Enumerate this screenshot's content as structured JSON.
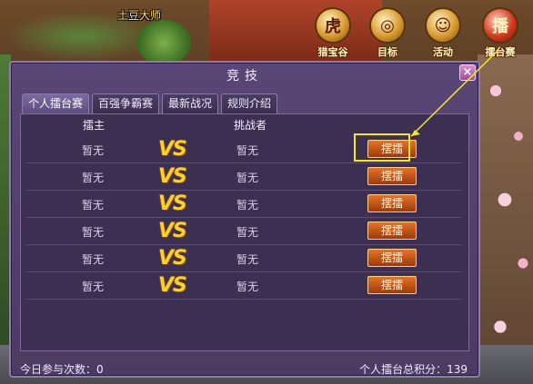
{
  "scene": {
    "player_name": "土豆大师"
  },
  "top_menu": [
    {
      "label": "猎宝谷",
      "icon": "treasure-tiger-icon"
    },
    {
      "label": "目标",
      "icon": "target-icon"
    },
    {
      "label": "活动",
      "icon": "event-icon"
    },
    {
      "label": "擂台赛",
      "icon": "arena-icon",
      "glyph": "播"
    }
  ],
  "dialog": {
    "title": "竞技",
    "close_label": "×",
    "tabs": [
      {
        "label": "个人擂台赛",
        "active": true
      },
      {
        "label": "百强争霸赛",
        "active": false
      },
      {
        "label": "最新战况",
        "active": false
      },
      {
        "label": "规则介绍",
        "active": false
      }
    ],
    "columns": {
      "host": "擂主",
      "challenger": "挑战者"
    },
    "rows": [
      {
        "host": "暂无",
        "vs": "VS",
        "challenger": "暂无",
        "action": "摆擂"
      },
      {
        "host": "暂无",
        "vs": "VS",
        "challenger": "暂无",
        "action": "摆擂"
      },
      {
        "host": "暂无",
        "vs": "VS",
        "challenger": "暂无",
        "action": "摆擂"
      },
      {
        "host": "暂无",
        "vs": "VS",
        "challenger": "暂无",
        "action": "摆擂"
      },
      {
        "host": "暂无",
        "vs": "VS",
        "challenger": "暂无",
        "action": "摆擂"
      },
      {
        "host": "暂无",
        "vs": "VS",
        "challenger": "暂无",
        "action": "摆擂"
      }
    ],
    "footer": {
      "participation": "今日参与次数：0",
      "total_score": "个人擂台总积分：139"
    }
  },
  "colors": {
    "dialog_bg": "#4b3b63",
    "vs": "#ffcf30",
    "action_button": "#c85a1c",
    "highlight": "#f5e629"
  }
}
